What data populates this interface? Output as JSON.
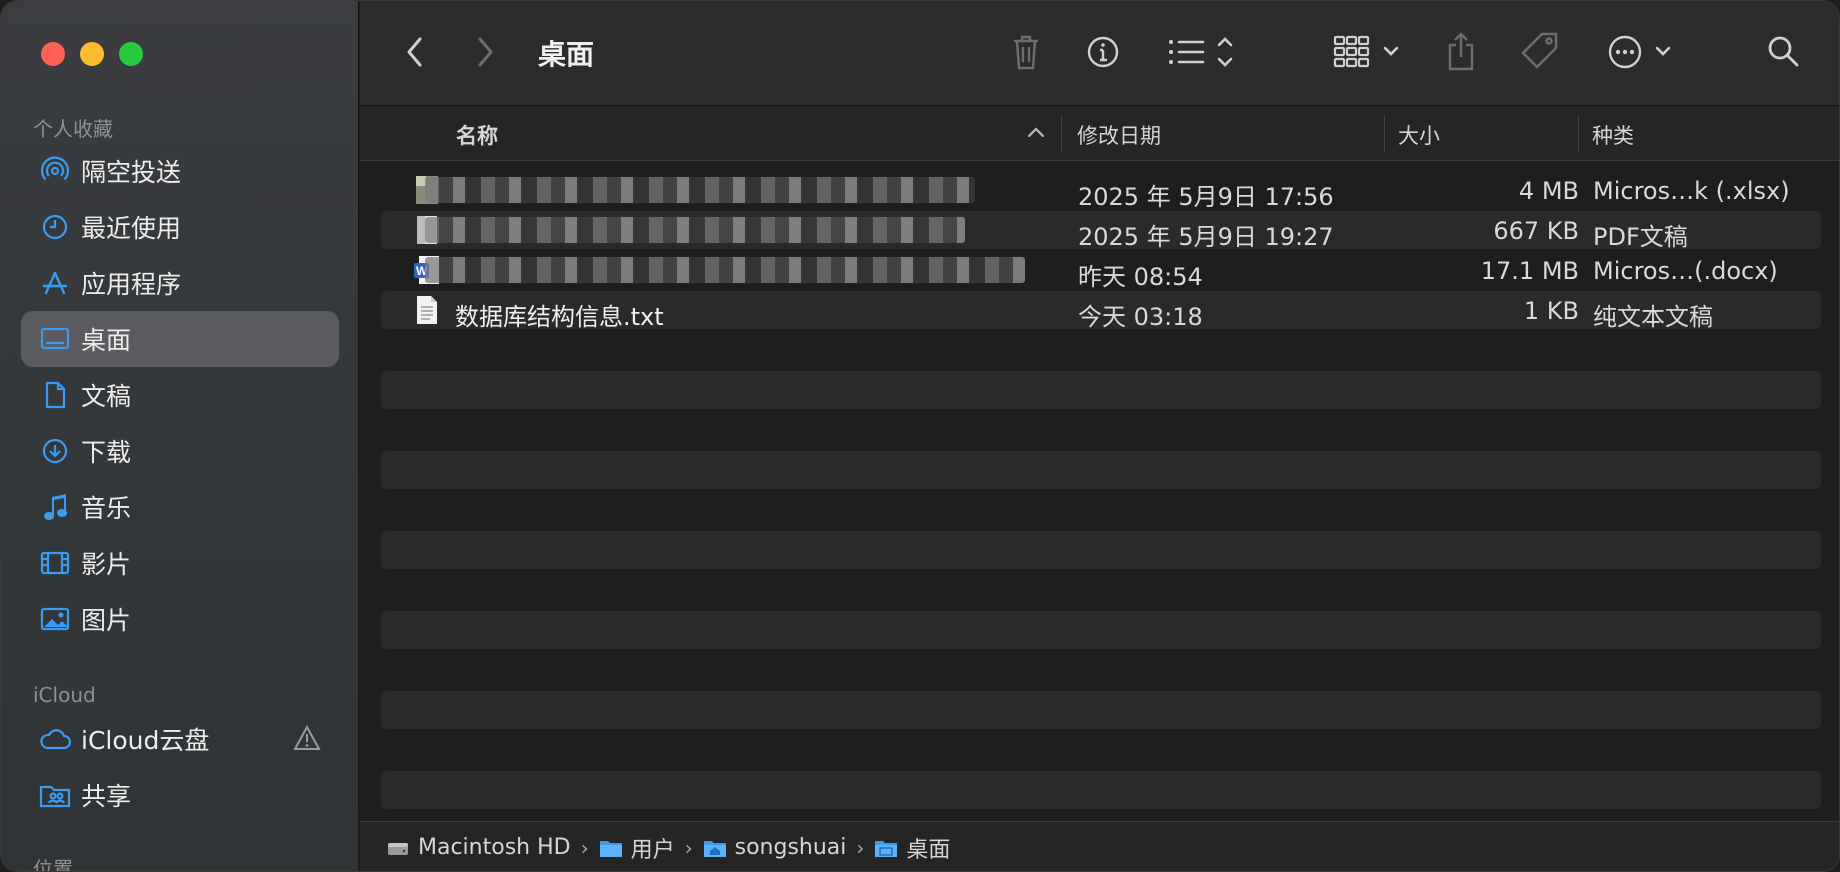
{
  "window": {
    "title": "桌面"
  },
  "sidebar": {
    "favorites_title": "个人收藏",
    "favorites": [
      {
        "label": "隔空投送",
        "icon": "airdrop-icon"
      },
      {
        "label": "最近使用",
        "icon": "clock-icon"
      },
      {
        "label": "应用程序",
        "icon": "applications-icon"
      },
      {
        "label": "桌面",
        "icon": "desktop-icon",
        "selected": true
      },
      {
        "label": "文稿",
        "icon": "document-icon"
      },
      {
        "label": "下载",
        "icon": "download-icon"
      },
      {
        "label": "音乐",
        "icon": "music-icon"
      },
      {
        "label": "影片",
        "icon": "film-icon"
      },
      {
        "label": "图片",
        "icon": "photo-icon"
      }
    ],
    "icloud_title": "iCloud",
    "icloud": [
      {
        "label": "iCloud云盘",
        "icon": "cloud-icon"
      },
      {
        "label": "共享",
        "icon": "shared-folder-icon"
      }
    ],
    "locations_title": "位置"
  },
  "columns": {
    "name": "名称",
    "date": "修改日期",
    "size": "大小",
    "kind": "种类"
  },
  "files": [
    {
      "name": "",
      "date": "2025 年 5月9日 17:56",
      "size": "4 MB",
      "kind": "Micros…k (.xlsx)",
      "icon": "xlsx-file-icon"
    },
    {
      "name": "",
      "date": "2025 年 5月9日 19:27",
      "size": "667 KB",
      "kind": "PDF文稿",
      "icon": "pdf-file-icon"
    },
    {
      "name": "",
      "date": "昨天 08:54",
      "size": "17.1 MB",
      "kind": "Micros…(.docx)",
      "icon": "word-file-icon"
    },
    {
      "name": "数据库结构信息.txt",
      "date": "今天 03:18",
      "size": "1 KB",
      "kind": "纯文本文稿",
      "icon": "text-file-icon"
    }
  ],
  "path": [
    {
      "label": "Macintosh HD",
      "icon": "hard-drive-icon"
    },
    {
      "label": "用户",
      "icon": "folder-icon"
    },
    {
      "label": "songshuai",
      "icon": "home-folder-icon"
    },
    {
      "label": "桌面",
      "icon": "desktop-folder-icon"
    }
  ],
  "colors": {
    "accent": "#3a9bf0",
    "selected_bg": "#5a5c5f",
    "window_bg": "#1e1e1e"
  }
}
